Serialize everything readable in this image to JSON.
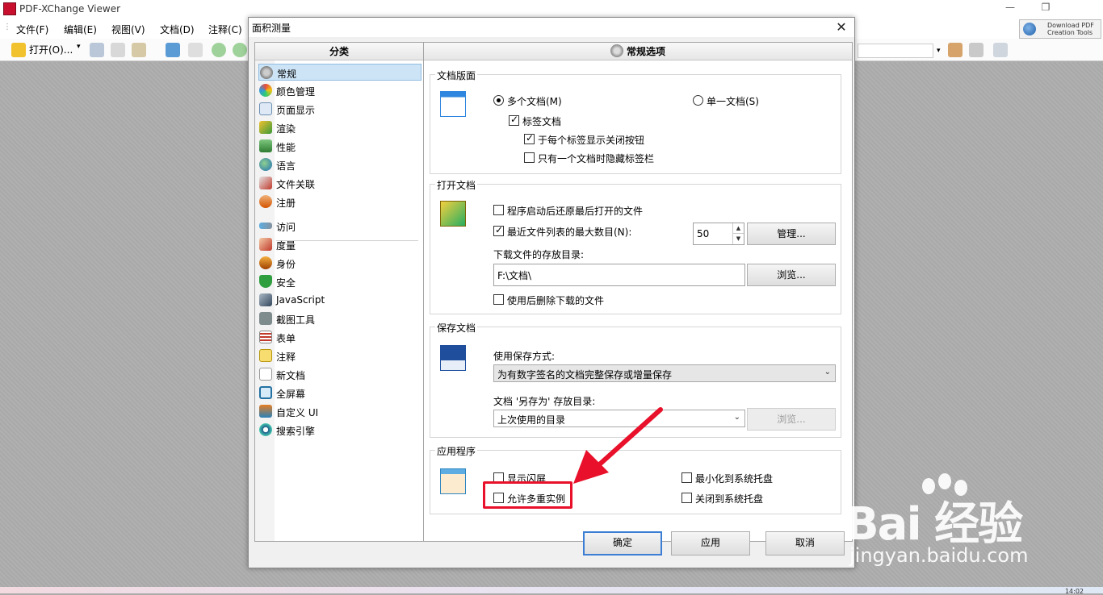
{
  "app": {
    "title": "PDF-XChange Viewer",
    "menu": [
      "文件(F)",
      "编辑(E)",
      "视图(V)",
      "文档(D)",
      "注释(C)"
    ],
    "toolbar_open": "打开(O)...",
    "download_line1": "Download PDF",
    "download_line2": "Creation Tools",
    "win_minimize": "—",
    "win_restore": "❐",
    "clock": "14:02"
  },
  "dialog": {
    "title": "面积测量",
    "close": "✕",
    "category_header": "分类",
    "options_header": "常规选项",
    "categories": [
      {
        "label": "常规",
        "icon": "gear-icon"
      },
      {
        "label": "颜色管理",
        "icon": "palette-icon"
      },
      {
        "label": "页面显示",
        "icon": "magnifier-icon"
      },
      {
        "label": "渲染",
        "icon": "brush-icon"
      },
      {
        "label": "性能",
        "icon": "chart-icon"
      },
      {
        "label": "语言",
        "icon": "globe-icon"
      },
      {
        "label": "文件关联",
        "icon": "file-assoc-icon"
      },
      {
        "label": "注册",
        "icon": "user-register-icon"
      },
      {
        "label": "访问",
        "icon": "link-icon"
      },
      {
        "label": "度量",
        "icon": "ruler-icon"
      },
      {
        "label": "身份",
        "icon": "identity-icon"
      },
      {
        "label": "安全",
        "icon": "shield-icon"
      },
      {
        "label": "JavaScript",
        "icon": "js-icon"
      },
      {
        "label": "截图工具",
        "icon": "camera-icon"
      },
      {
        "label": "表单",
        "icon": "form-icon"
      },
      {
        "label": "注释",
        "icon": "comment-icon"
      },
      {
        "label": "新文档",
        "icon": "new-doc-icon"
      },
      {
        "label": "全屏幕",
        "icon": "fullscreen-icon"
      },
      {
        "label": "自定义 UI",
        "icon": "customize-icon"
      },
      {
        "label": "搜索引擎",
        "icon": "search-engine-icon"
      }
    ],
    "doc_layout": {
      "title": "文档版面",
      "multi_doc": "多个文档(M)",
      "single_doc": "单一文档(S)",
      "tab_docs": "标签文档",
      "show_close": "于每个标签显示关闭按钮",
      "hide_tabbar": "只有一个文档时隐藏标签栏"
    },
    "open_docs": {
      "title": "打开文档",
      "restore_last": "程序启动后还原最后打开的文件",
      "recent_max": "最近文件列表的最大数目(N):",
      "recent_value": "50",
      "manage": "管理...",
      "download_dir_label": "下载文件的存放目录:",
      "download_dir_value": "F:\\文档\\",
      "browse": "浏览...",
      "delete_after": "使用后删除下载的文件"
    },
    "save_docs": {
      "title": "保存文档",
      "method_label": "使用保存方式:",
      "method_value": "为有数字签名的文档完整保存或增量保存",
      "saveas_label": "文档 '另存为' 存放目录:",
      "saveas_value": "上次使用的目录",
      "browse": "浏览..."
    },
    "application": {
      "title": "应用程序",
      "splash": "显示闪屏",
      "multi_instance": "允许多重实例",
      "minimize_tray": "最小化到系统托盘",
      "close_tray": "关闭到系统托盘"
    },
    "buttons": {
      "ok": "确定",
      "apply": "应用",
      "cancel": "取消"
    }
  },
  "watermark": {
    "main": "Bai 经验",
    "sub": "jingyan.baidu.com"
  }
}
